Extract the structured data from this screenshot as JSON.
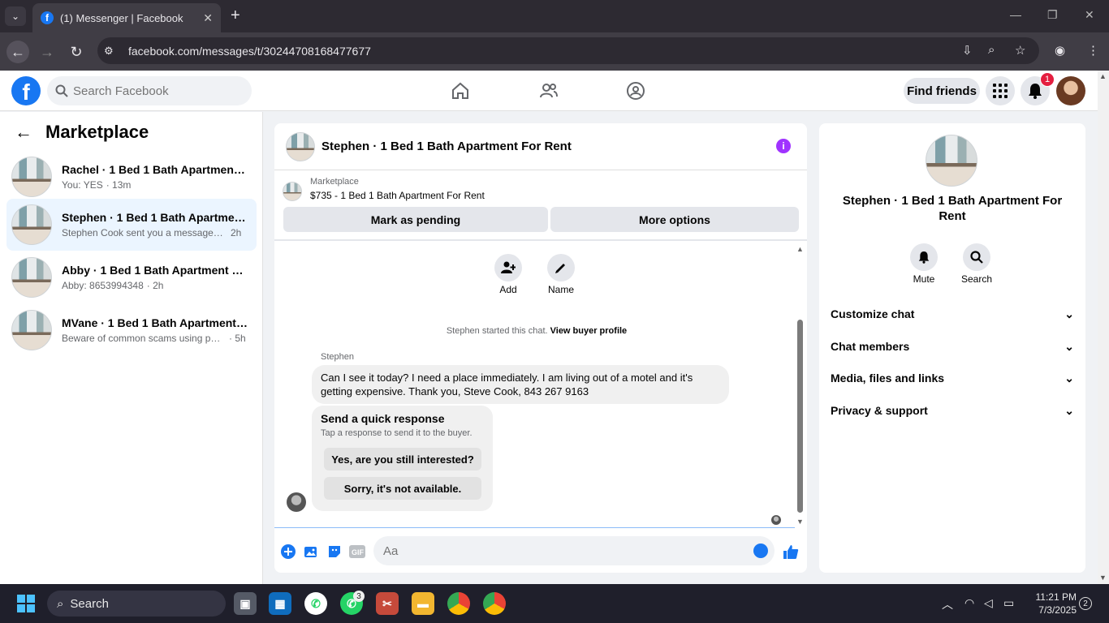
{
  "browser": {
    "tab_title": "(1) Messenger | Facebook",
    "url": "facebook.com/messages/t/30244708168477677"
  },
  "header": {
    "search_placeholder": "Search Facebook",
    "find_friends": "Find friends",
    "notification_count": "1"
  },
  "left": {
    "title": "Marketplace",
    "conversations": [
      {
        "name": "Rachel · 1 Bed 1 Bath Apartment F...",
        "sub": "You: YES",
        "time": "· 13m",
        "active": false
      },
      {
        "name": "Stephen · 1 Bed 1 Bath Apartment ...",
        "sub": "Stephen Cook sent you a message ab...",
        "time": "2h",
        "active": true
      },
      {
        "name": "Abby · 1 Bed 1 Bath Apartment For...",
        "sub": "Abby: 8653994348",
        "time": "· 2h",
        "active": false
      },
      {
        "name": "MVane · 1 Bed 1 Bath Apartment F...",
        "sub": "Beware of common scams using pay...",
        "time": "· 5h",
        "active": false
      }
    ]
  },
  "chat": {
    "title": "Stephen · 1 Bed 1 Bath Apartment For Rent",
    "listing_label": "Marketplace",
    "listing_price": "$735 - 1 Bed 1 Bath Apartment For Rent",
    "mark_pending": "Mark as pending",
    "more_options": "More options",
    "add_label": "Add",
    "name_label": "Name",
    "started_text": "Stephen started this chat.",
    "view_buyer": "View buyer profile",
    "sender": "Stephen",
    "message": "Can I see it today? I need a place immediately. I am living out of a motel and it's getting expensive. Thank you, Steve Cook, 843 267 9163",
    "quick_title": "Send a quick response",
    "quick_sub": "Tap a response to send it to the buyer.",
    "quick_1": "Yes, are you still interested?",
    "quick_2": "Sorry, it's not available.",
    "input_placeholder": "Aa"
  },
  "right": {
    "title": "Stephen · 1 Bed 1 Bath Apartment For Rent",
    "mute": "Mute",
    "search": "Search",
    "sections": [
      "Customize chat",
      "Chat members",
      "Media, files and links",
      "Privacy & support"
    ]
  },
  "taskbar": {
    "search": "Search",
    "whatsapp_badge": "3",
    "time": "11:21 PM",
    "date": "7/3/2025",
    "notif_count": "2"
  }
}
